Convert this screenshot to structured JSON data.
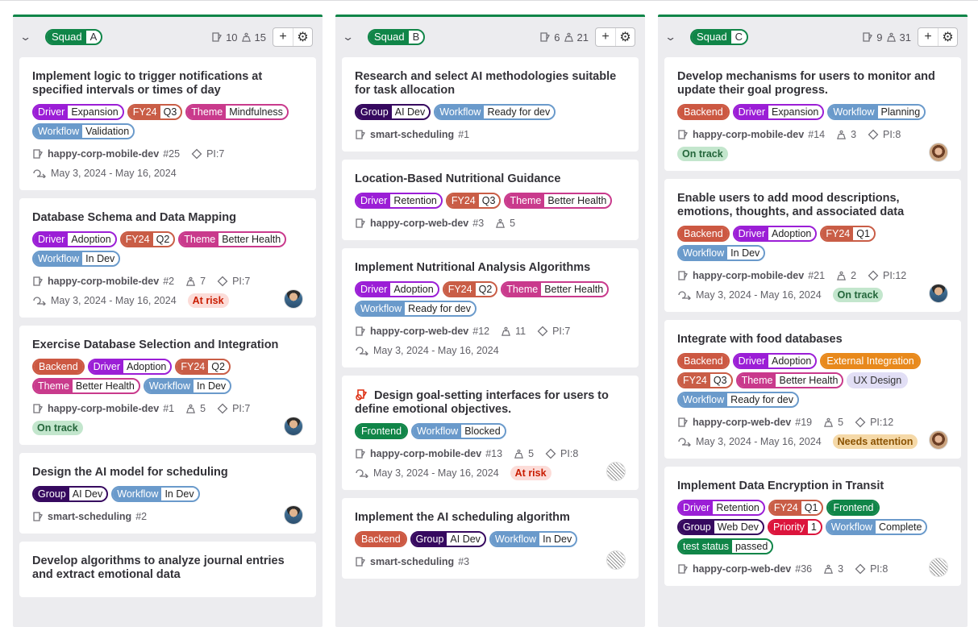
{
  "colors": {
    "driver": "#9b1ed6",
    "fy24": "#c95d46",
    "theme": "#c93a8c",
    "workflow": "#6a9acb",
    "backend": "#cc5842",
    "group": "#36095f",
    "frontend": "#108548",
    "external": "#e8891c",
    "ux": "#e1def5",
    "priority": "#dc143c",
    "test": "#108548",
    "squad": "#108548"
  },
  "status_styles": {
    "At risk": [
      "#fcdcd8",
      "#c91c00"
    ],
    "On track": [
      "#c3e6cd",
      "#24663b"
    ],
    "Needs attention": [
      "#f5d9a8",
      "#8a5100"
    ]
  },
  "columns": [
    {
      "squad_key": "Squad",
      "squad_value": "A",
      "issues": "10",
      "weight": "15",
      "cards": [
        {
          "title": "Implement logic to trigger notifications at specified intervals or times of day",
          "labels": [
            [
              "Driver",
              "Expansion",
              "driver"
            ],
            [
              "FY24",
              "Q3",
              "fy24"
            ],
            [
              "Theme",
              "Mindfulness",
              "theme"
            ],
            [
              "Workflow",
              "Validation",
              "workflow"
            ]
          ],
          "ref": "happy-corp-mobile-dev",
          "num": "#25",
          "pi": "PI:7",
          "dates": "May 3, 2024 - May 16, 2024"
        },
        {
          "title": "Database Schema and Data Mapping",
          "labels": [
            [
              "Driver",
              "Adoption",
              "driver"
            ],
            [
              "FY24",
              "Q2",
              "fy24"
            ],
            [
              "Theme",
              "Better Health",
              "theme"
            ],
            [
              "Workflow",
              "In Dev",
              "workflow"
            ]
          ],
          "ref": "happy-corp-mobile-dev",
          "num": "#2",
          "weight": "7",
          "pi": "PI:7",
          "dates": "May 3, 2024 - May 16, 2024",
          "status": "At risk",
          "avatar": "man"
        },
        {
          "title": "Exercise Database Selection and Integration",
          "labels": [
            [
              "Backend",
              "",
              "backend"
            ],
            [
              "Driver",
              "Adoption",
              "driver"
            ],
            [
              "FY24",
              "Q2",
              "fy24"
            ],
            [
              "Theme",
              "Better Health",
              "theme"
            ],
            [
              "Workflow",
              "In Dev",
              "workflow"
            ]
          ],
          "ref": "happy-corp-mobile-dev",
          "num": "#1",
          "weight": "5",
          "pi": "PI:7",
          "status": "On track",
          "avatar": "man"
        },
        {
          "title": "Design the AI model for scheduling",
          "labels": [
            [
              "Group",
              "AI Dev",
              "group"
            ],
            [
              "Workflow",
              "In Dev",
              "workflow"
            ]
          ],
          "ref": "smart-scheduling",
          "num": "#2",
          "avatar": "man"
        },
        {
          "title": "Develop algorithms to analyze journal entries and extract emotional data",
          "labels": []
        }
      ]
    },
    {
      "squad_key": "Squad",
      "squad_value": "B",
      "issues": "6",
      "weight": "21",
      "cards": [
        {
          "title": "Research and select AI methodologies suitable for task allocation",
          "labels": [
            [
              "Group",
              "AI Dev",
              "group"
            ],
            [
              "Workflow",
              "Ready for dev",
              "workflow"
            ]
          ],
          "ref": "smart-scheduling",
          "num": "#1"
        },
        {
          "title": "Location-Based Nutritional Guidance",
          "labels": [
            [
              "Driver",
              "Retention",
              "driver"
            ],
            [
              "FY24",
              "Q3",
              "fy24"
            ],
            [
              "Theme",
              "Better Health",
              "theme"
            ]
          ],
          "ref": "happy-corp-web-dev",
          "num": "#3",
          "weight": "5"
        },
        {
          "title": "Implement Nutritional Analysis Algorithms",
          "labels": [
            [
              "Driver",
              "Adoption",
              "driver"
            ],
            [
              "FY24",
              "Q2",
              "fy24"
            ],
            [
              "Theme",
              "Better Health",
              "theme"
            ],
            [
              "Workflow",
              "Ready for dev",
              "workflow"
            ]
          ],
          "ref": "happy-corp-web-dev",
          "num": "#12",
          "weight": "11",
          "pi": "PI:7",
          "dates": "May 3, 2024 - May 16, 2024"
        },
        {
          "title": "Design goal-setting interfaces for users to define emotional objectives.",
          "blocked": true,
          "labels": [
            [
              "Frontend",
              "",
              "frontend"
            ],
            [
              "Workflow",
              "Blocked",
              "workflow"
            ]
          ],
          "ref": "happy-corp-mobile-dev",
          "num": "#13",
          "weight": "5",
          "pi": "PI:8",
          "dates": "May 3, 2024 - May 16, 2024",
          "status": "At risk",
          "avatar": "sketch"
        },
        {
          "title": "Implement the AI scheduling algorithm",
          "labels": [
            [
              "Backend",
              "",
              "backend"
            ],
            [
              "Group",
              "AI Dev",
              "group"
            ],
            [
              "Workflow",
              "In Dev",
              "workflow"
            ]
          ],
          "ref": "smart-scheduling",
          "num": "#3",
          "avatar": "sketch"
        }
      ]
    },
    {
      "squad_key": "Squad",
      "squad_value": "C",
      "issues": "9",
      "weight": "31",
      "cards": [
        {
          "title": "Develop mechanisms for users to monitor and update their goal progress.",
          "labels": [
            [
              "Backend",
              "",
              "backend"
            ],
            [
              "Driver",
              "Expansion",
              "driver"
            ],
            [
              "Workflow",
              "Planning",
              "workflow"
            ]
          ],
          "ref": "happy-corp-mobile-dev",
          "num": "#14",
          "weight": "3",
          "pi": "PI:8",
          "status": "On track",
          "avatar": "woman"
        },
        {
          "title": "Enable users to add mood descriptions, emotions, thoughts, and associated data",
          "labels": [
            [
              "Backend",
              "",
              "backend"
            ],
            [
              "Driver",
              "Adoption",
              "driver"
            ],
            [
              "FY24",
              "Q1",
              "fy24"
            ],
            [
              "Workflow",
              "In Dev",
              "workflow"
            ]
          ],
          "ref": "happy-corp-mobile-dev",
          "num": "#21",
          "weight": "2",
          "pi": "PI:12",
          "dates": "May 3, 2024 - May 16, 2024",
          "status": "On track",
          "avatar": "man"
        },
        {
          "title": "Integrate with food databases",
          "labels": [
            [
              "Backend",
              "",
              "backend"
            ],
            [
              "Driver",
              "Adoption",
              "driver"
            ],
            [
              "External Integration",
              "",
              "external"
            ],
            [
              "FY24",
              "Q3",
              "fy24"
            ],
            [
              "Theme",
              "Better Health",
              "theme"
            ],
            [
              "UX Design",
              "",
              "ux"
            ],
            [
              "Workflow",
              "Ready for dev",
              "workflow"
            ]
          ],
          "ref": "happy-corp-web-dev",
          "num": "#19",
          "weight": "5",
          "pi": "PI:12",
          "dates": "May 3, 2024 - May 16, 2024",
          "status": "Needs attention",
          "avatar": "woman"
        },
        {
          "title": "Implement Data Encryption in Transit",
          "labels": [
            [
              "Driver",
              "Retention",
              "driver"
            ],
            [
              "FY24",
              "Q1",
              "fy24"
            ],
            [
              "Frontend",
              "",
              "frontend"
            ],
            [
              "Group",
              "Web Dev",
              "group"
            ],
            [
              "Priority",
              "1",
              "priority"
            ],
            [
              "Workflow",
              "Complete",
              "workflow"
            ],
            [
              "test status",
              "passed",
              "test"
            ]
          ],
          "ref": "happy-corp-web-dev",
          "num": "#36",
          "weight": "3",
          "pi": "PI:8",
          "avatar": "sketch"
        }
      ]
    }
  ]
}
